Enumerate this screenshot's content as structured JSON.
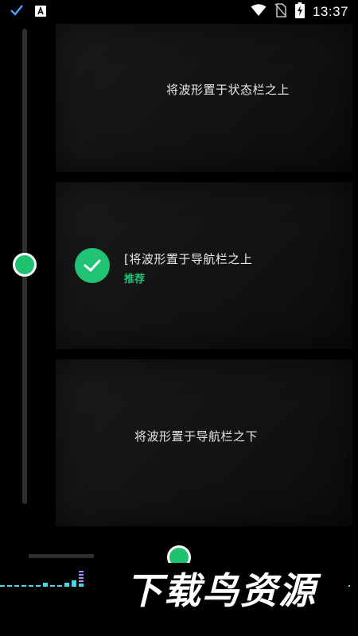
{
  "status_bar": {
    "time": "13:37",
    "left_icons": [
      "check-icon",
      "a-icon"
    ],
    "right_icons": [
      "wifi-icon",
      "no-sim-icon",
      "battery-charging-icon"
    ]
  },
  "slider": {
    "selected_index": 1,
    "option_count": 3
  },
  "options": [
    {
      "label": "将波形置于状态栏之上"
    },
    {
      "label": "[将波形置于导航栏之上",
      "sublabel": "推荐",
      "selected": true
    },
    {
      "label": "将波形置于导航栏之下"
    }
  ],
  "watermark": {
    "text": "下载鸟资源"
  },
  "colors": {
    "accent": "#20c474",
    "card": "#151515",
    "track": "#2f2f2f"
  }
}
